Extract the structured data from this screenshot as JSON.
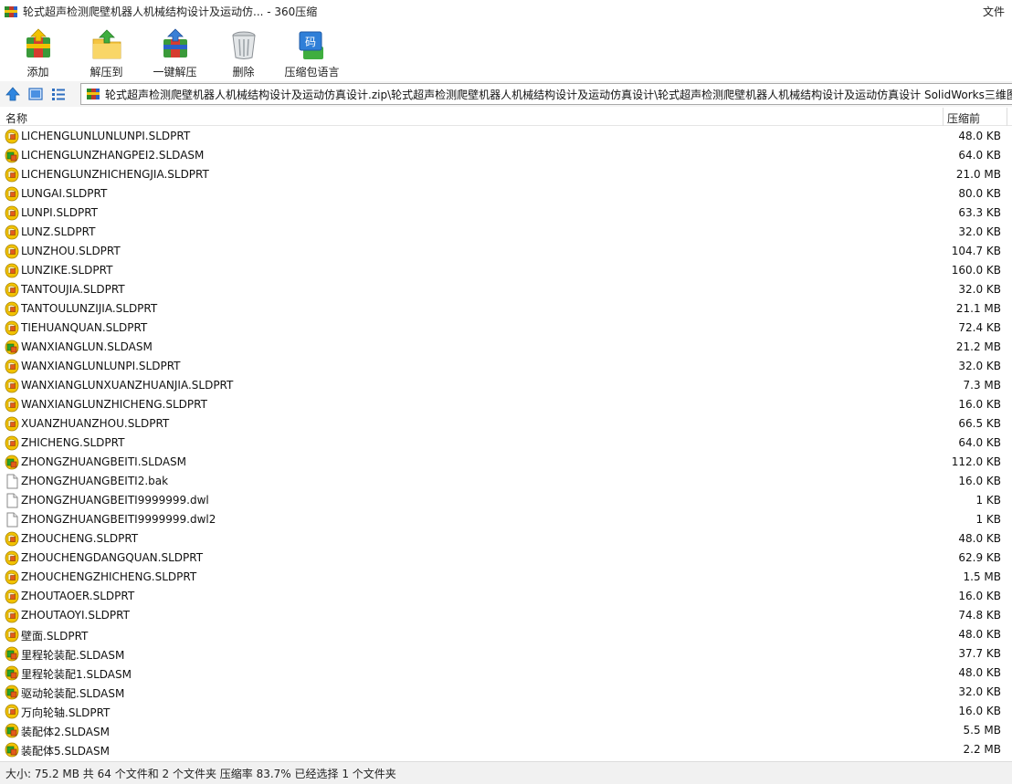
{
  "window": {
    "title": "轮式超声检测爬壁机器人机械结构设计及运动仿... - 360压缩",
    "menu_file": "文件"
  },
  "toolbar": {
    "buttons": [
      {
        "label": "添加",
        "icon": "add-archive-icon"
      },
      {
        "label": "解压到",
        "icon": "extract-to-icon"
      },
      {
        "label": "一键解压",
        "icon": "one-click-extract-icon"
      },
      {
        "label": "删除",
        "icon": "delete-icon"
      },
      {
        "label": "压缩包语言",
        "icon": "archive-language-icon"
      }
    ]
  },
  "address": {
    "path": "轮式超声检测爬壁机器人机械结构设计及运动仿真设计.zip\\轮式超声检测爬壁机器人机械结构设计及运动仿真设计\\轮式超声检测爬壁机器人机械结构设计及运动仿真设计 SolidWorks三维图"
  },
  "columns": {
    "name": "名称",
    "size": "压缩前"
  },
  "files": [
    {
      "name": "LICHENGLUNLUNLUNPI.SLDPRT",
      "size": "48.0 KB",
      "type": "part"
    },
    {
      "name": "LICHENGLUNZHANGPEI2.SLDASM",
      "size": "64.0 KB",
      "type": "asm"
    },
    {
      "name": "LICHENGLUNZHICHENGJIA.SLDPRT",
      "size": "21.0 MB",
      "type": "part"
    },
    {
      "name": "LUNGAI.SLDPRT",
      "size": "80.0 KB",
      "type": "part"
    },
    {
      "name": "LUNPI.SLDPRT",
      "size": "63.3 KB",
      "type": "part"
    },
    {
      "name": "LUNZ.SLDPRT",
      "size": "32.0 KB",
      "type": "part"
    },
    {
      "name": "LUNZHOU.SLDPRT",
      "size": "104.7 KB",
      "type": "part"
    },
    {
      "name": "LUNZIKE.SLDPRT",
      "size": "160.0 KB",
      "type": "part"
    },
    {
      "name": "TANTOUJIA.SLDPRT",
      "size": "32.0 KB",
      "type": "part"
    },
    {
      "name": "TANTOULUNZIJIA.SLDPRT",
      "size": "21.1 MB",
      "type": "part"
    },
    {
      "name": "TIEHUANQUAN.SLDPRT",
      "size": "72.4 KB",
      "type": "part"
    },
    {
      "name": "WANXIANGLUN.SLDASM",
      "size": "21.2 MB",
      "type": "asm"
    },
    {
      "name": "WANXIANGLUNLUNPI.SLDPRT",
      "size": "32.0 KB",
      "type": "part"
    },
    {
      "name": "WANXIANGLUNXUANZHUANJIA.SLDPRT",
      "size": "7.3 MB",
      "type": "part"
    },
    {
      "name": "WANXIANGLUNZHICHENG.SLDPRT",
      "size": "16.0 KB",
      "type": "part"
    },
    {
      "name": "XUANZHUANZHOU.SLDPRT",
      "size": "66.5 KB",
      "type": "part"
    },
    {
      "name": "ZHICHENG.SLDPRT",
      "size": "64.0 KB",
      "type": "part"
    },
    {
      "name": "ZHONGZHUANGBEITI.SLDASM",
      "size": "112.0 KB",
      "type": "asm"
    },
    {
      "name": "ZHONGZHUANGBEITI2.bak",
      "size": "16.0 KB",
      "type": "doc"
    },
    {
      "name": "ZHONGZHUANGBEITI9999999.dwl",
      "size": "1 KB",
      "type": "doc"
    },
    {
      "name": "ZHONGZHUANGBEITI9999999.dwl2",
      "size": "1 KB",
      "type": "doc"
    },
    {
      "name": "ZHOUCHENG.SLDPRT",
      "size": "48.0 KB",
      "type": "part"
    },
    {
      "name": "ZHOUCHENGDANGQUAN.SLDPRT",
      "size": "62.9 KB",
      "type": "part"
    },
    {
      "name": "ZHOUCHENGZHICHENG.SLDPRT",
      "size": "1.5 MB",
      "type": "part"
    },
    {
      "name": "ZHOUTAOER.SLDPRT",
      "size": "16.0 KB",
      "type": "part"
    },
    {
      "name": "ZHOUTAOYI.SLDPRT",
      "size": "74.8 KB",
      "type": "part"
    },
    {
      "name": "壁面.SLDPRT",
      "size": "48.0 KB",
      "type": "part"
    },
    {
      "name": "里程轮装配.SLDASM",
      "size": "37.7 KB",
      "type": "asm"
    },
    {
      "name": "里程轮装配1.SLDASM",
      "size": "48.0 KB",
      "type": "asm"
    },
    {
      "name": "驱动轮装配.SLDASM",
      "size": "32.0 KB",
      "type": "asm"
    },
    {
      "name": "万向轮轴.SLDPRT",
      "size": "16.0 KB",
      "type": "part"
    },
    {
      "name": "装配体2.SLDASM",
      "size": "5.5 MB",
      "type": "asm"
    },
    {
      "name": "装配体5.SLDASM",
      "size": "2.2 MB",
      "type": "asm"
    }
  ],
  "status": {
    "text": "大小: 75.2 MB 共 64 个文件和 2 个文件夹 压缩率 83.7% 已经选择 1 个文件夹"
  },
  "colors": {
    "part_icon": "#f2c200",
    "asm_icon": "#2aa52a",
    "accent": "#1e73be"
  }
}
